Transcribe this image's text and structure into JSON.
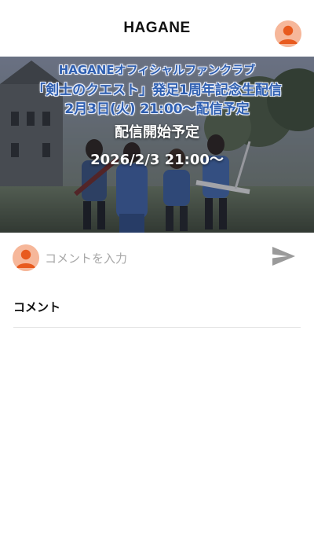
{
  "header": {
    "title": "HAGANE",
    "avatar_icon": "user-avatar-icon"
  },
  "banner": {
    "promo_line_1": "HAGANEオフィシャルファンクラブ",
    "promo_line_2": "「剣士のクエスト」発足1周年記念生配信",
    "promo_line_3": "2月3日(火) 21:00〜配信予定",
    "status": "配信開始予定",
    "start_time": "2026/2/3 21:00〜"
  },
  "comment_form": {
    "avatar_icon": "user-avatar-icon",
    "value": "",
    "placeholder": "コメントを入力",
    "send_icon": "send-icon"
  },
  "comments": {
    "heading": "コメント"
  },
  "colors": {
    "avatar_bg": "#f6b79a",
    "avatar_fg": "#e85a1e",
    "promo_text": "#2f5fb0",
    "send_icon": "#9a9a9a",
    "divider": "#e3e3e3"
  }
}
